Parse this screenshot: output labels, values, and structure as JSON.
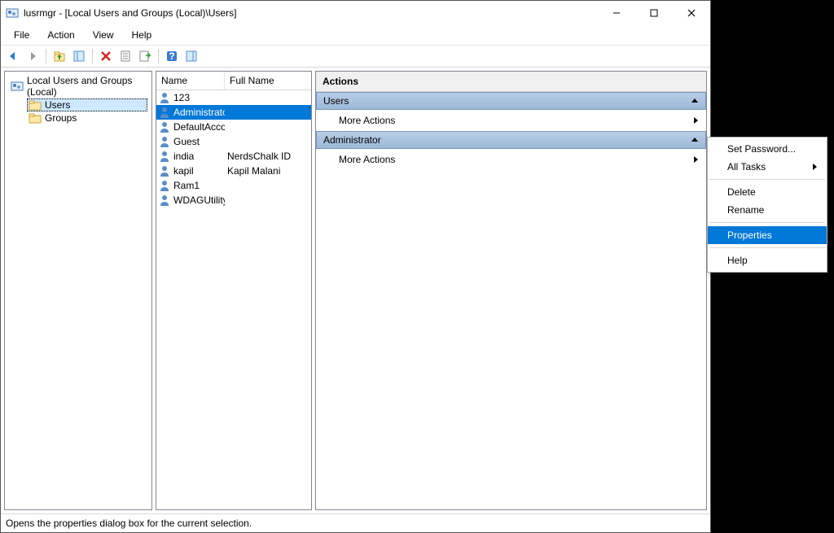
{
  "window": {
    "title": "lusrmgr - [Local Users and Groups (Local)\\Users]"
  },
  "menu": {
    "file": "File",
    "action": "Action",
    "view": "View",
    "help": "Help"
  },
  "tree": {
    "root": "Local Users and Groups (Local)",
    "users": "Users",
    "groups": "Groups"
  },
  "list": {
    "col_name": "Name",
    "col_full": "Full Name",
    "rows": [
      {
        "name": "123",
        "full": ""
      },
      {
        "name": "Administrator",
        "full": ""
      },
      {
        "name": "DefaultAcco...",
        "full": ""
      },
      {
        "name": "Guest",
        "full": ""
      },
      {
        "name": "india",
        "full": "NerdsChalk ID"
      },
      {
        "name": "kapil",
        "full": "Kapil Malani"
      },
      {
        "name": "Ram1",
        "full": ""
      },
      {
        "name": "WDAGUtility...",
        "full": ""
      }
    ],
    "selected": 1
  },
  "actions": {
    "header": "Actions",
    "section1": "Users",
    "more": "More Actions",
    "section2": "Administrator"
  },
  "context_menu": {
    "set_password": "Set Password...",
    "all_tasks": "All Tasks",
    "delete": "Delete",
    "rename": "Rename",
    "properties": "Properties",
    "help": "Help",
    "selected": "properties"
  },
  "status": "Opens the properties dialog box for the current selection."
}
